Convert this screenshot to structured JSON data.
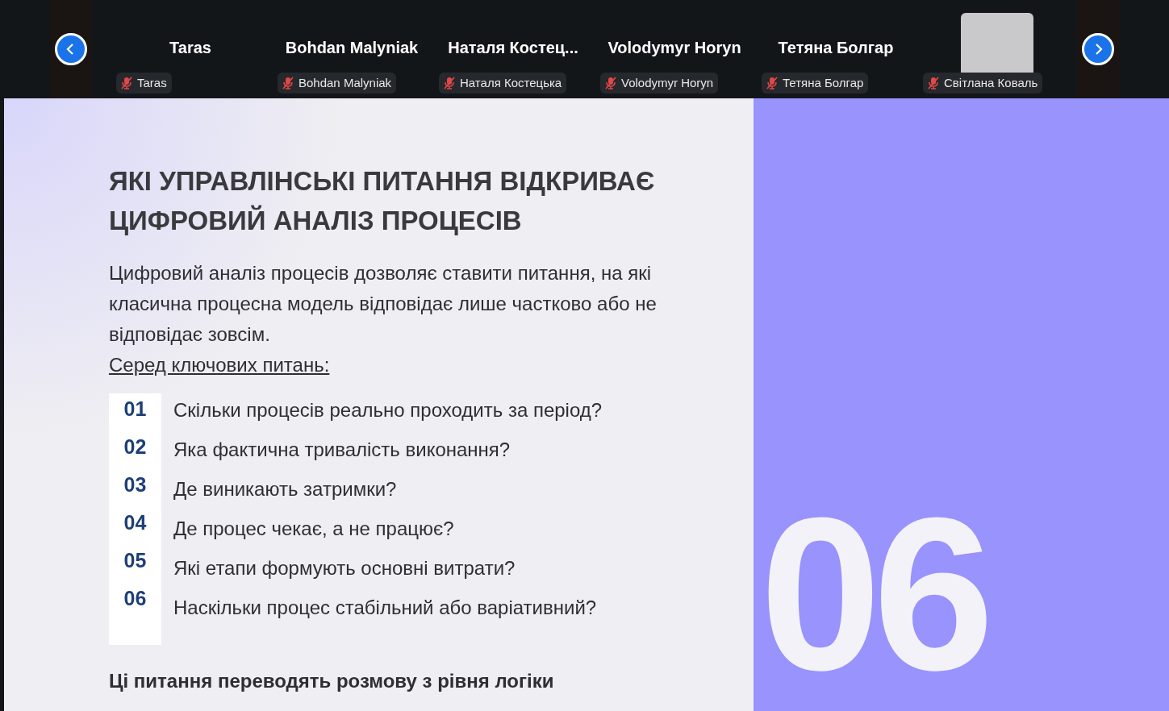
{
  "participants": [
    {
      "kind": "name",
      "name": "Taras",
      "label": "Taras",
      "muted": true
    },
    {
      "kind": "name",
      "name": "Bohdan Malyniak",
      "label": "Bohdan Malyniak",
      "muted": true
    },
    {
      "kind": "name",
      "name": "Наталя  Костец...",
      "label": "Наталя Костецька",
      "muted": true
    },
    {
      "kind": "name",
      "name": "Volodymyr Horyn",
      "label": "Volodymyr Horyn",
      "muted": true
    },
    {
      "kind": "name",
      "name": "Тетяна Болгар",
      "label": "Тетяна Болгар",
      "muted": true
    },
    {
      "kind": "photo",
      "label": "Світлана Коваль",
      "muted": true
    }
  ],
  "slide": {
    "title": "ЯКІ УПРАВЛІНСЬКІ ПИТАННЯ ВІДКРИВАЄ ЦИФРОВИЙ АНАЛІЗ ПРОЦЕСІВ",
    "intro": "Цифровий аналіз процесів дозволяє ставити питання, на які класична процесна модель відповідає лише частково або не відповідає зовсім.",
    "subheading": "Серед ключових питань:",
    "questions": [
      {
        "number": "01",
        "text": "Скільки процесів реально проходить за період?"
      },
      {
        "number": "02",
        "text": "Яка фактична тривалість виконання?"
      },
      {
        "number": "03",
        "text": "Де виникають затримки?"
      },
      {
        "number": "04",
        "text": "Де процес чекає, а не працює?"
      },
      {
        "number": "05",
        "text": "Які етапи формують основні витрати?"
      },
      {
        "number": "06",
        "text": "Наскільки процес стабільний або варіативний?"
      }
    ],
    "conclusion": "Ці питання переводять розмову з рівня логіки",
    "slide_number": "06"
  }
}
